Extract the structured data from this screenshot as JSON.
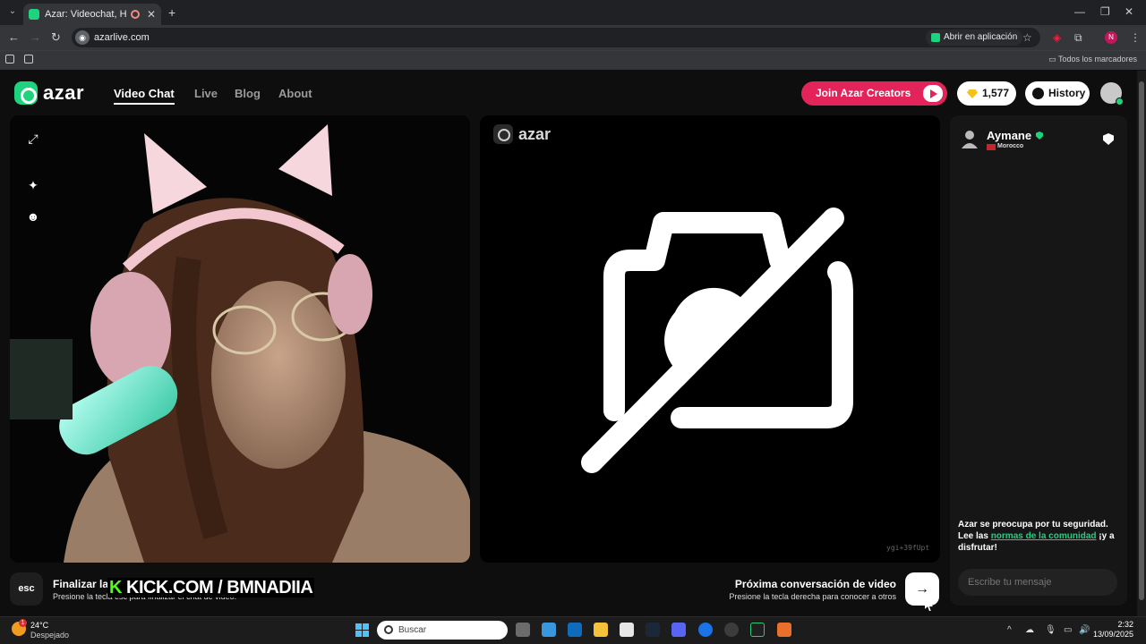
{
  "browser": {
    "tab_title": "Azar: Videochat, Haz nuevo",
    "url": "azarlive.com",
    "open_in_app": "Abrir en aplicación",
    "profile_initial": "N",
    "all_bookmarks": "Todos los marcadores"
  },
  "header": {
    "logo_text": "azar",
    "nav": [
      {
        "label": "Video Chat",
        "active": true
      },
      {
        "label": "Live",
        "active": false
      },
      {
        "label": "Blog",
        "active": false
      },
      {
        "label": "About",
        "active": false
      }
    ],
    "join_label": "Join Azar Creators",
    "gems": "1,577",
    "history_label": "History"
  },
  "left_panel": {
    "controls": [
      "expand-icon",
      "sparkle-effects-icon",
      "face-mask-icon"
    ]
  },
  "mid_panel": {
    "logo_text": "azar",
    "camera_state": "camera-off-icon",
    "video_id": "ygi+39fUpt"
  },
  "right_panel": {
    "peer_name": "Aymane",
    "peer_country": "Morocco",
    "safety_text_1": "Azar se preocupa por tu seguridad. Lee las ",
    "safety_link": "normas de la comunidad",
    "safety_text_2": " ¡y a disfrutar!",
    "message_placeholder": "Escribe tu mensaje"
  },
  "bottom": {
    "esc_label": "esc",
    "end_title": "Finalizar la",
    "end_sub": "Presione la tecla esc para finalizar el chat de video.",
    "overlay_k": "K",
    "overlay_text": "KICK.COM / BMNADIIA",
    "next_title": "Próxima conversación de video",
    "next_sub": "Presione la tecla derecha para conocer a otros",
    "next_arrow": "→"
  },
  "taskbar": {
    "weather_badge": "1",
    "temperature": "24°C",
    "condition": "Despejado",
    "search_placeholder": "Buscar",
    "time": "2:32",
    "date": "13/09/2025"
  },
  "colors": {
    "accent_green": "#1ed37d",
    "brand_pink": "#e3245a",
    "kick_green": "#53fc18"
  }
}
